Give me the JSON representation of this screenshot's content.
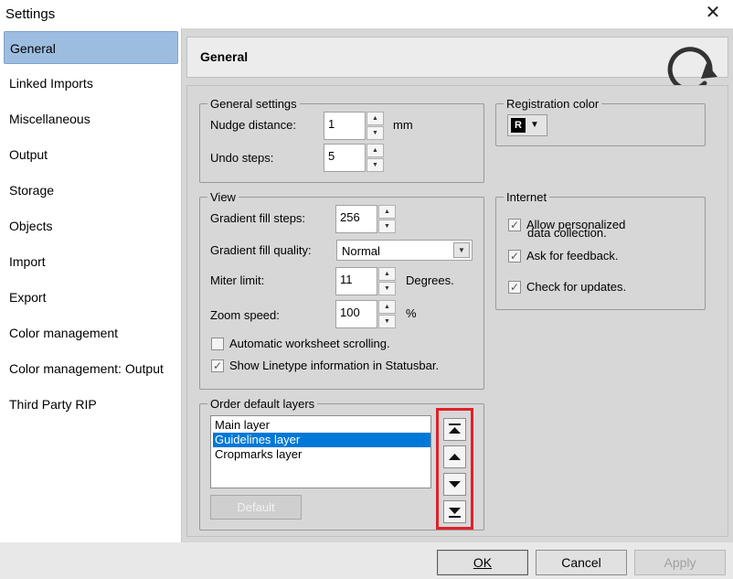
{
  "window": {
    "title": "Settings",
    "close_glyph": "✕"
  },
  "sidebar": {
    "items": [
      {
        "label": "General"
      },
      {
        "label": "Linked Imports"
      },
      {
        "label": "Miscellaneous"
      },
      {
        "label": "Output"
      },
      {
        "label": "Storage"
      },
      {
        "label": "Objects"
      },
      {
        "label": "Import"
      },
      {
        "label": "Export"
      },
      {
        "label": "Color management"
      },
      {
        "label": "Color management: Output"
      },
      {
        "label": "Third Party RIP"
      }
    ],
    "selected": "General"
  },
  "header": {
    "title": "General",
    "icon": "refresh-icon"
  },
  "general_settings": {
    "legend": "General settings",
    "nudge_label": "Nudge distance:",
    "nudge_value": "1",
    "nudge_unit": "mm",
    "undo_label": "Undo steps:",
    "undo_value": "5"
  },
  "registration": {
    "legend": "Registration color",
    "badge": "R"
  },
  "view": {
    "legend": "View",
    "gradient_steps_label": "Gradient fill steps:",
    "gradient_steps_value": "256",
    "gradient_quality_label": "Gradient fill quality:",
    "gradient_quality_value": "Normal",
    "miter_label": "Miter limit:",
    "miter_value": "11",
    "miter_unit": "Degrees.",
    "zoom_label": "Zoom speed:",
    "zoom_value": "100",
    "zoom_unit": "%",
    "auto_scroll_label": "Automatic worksheet scrolling.",
    "auto_scroll_checked": false,
    "linetype_label": "Show Linetype information in Statusbar.",
    "linetype_checked": true
  },
  "internet": {
    "legend": "Internet",
    "personalized_label_1": "Allow personalized",
    "personalized_label_2": "data collection.",
    "personalized_checked": true,
    "feedback_label": "Ask for feedback.",
    "feedback_checked": true,
    "updates_label": "Check for updates.",
    "updates_checked": true
  },
  "layers": {
    "legend": "Order default layers",
    "items": [
      "Main layer",
      "Guidelines layer",
      "Cropmarks layer"
    ],
    "selected": "Guidelines layer",
    "default_button": "Default"
  },
  "buttons": {
    "ok": "OK",
    "cancel": "Cancel",
    "apply": "Apply"
  },
  "colors": {
    "highlight_frame": "#e0202a",
    "selection": "#0078d7",
    "sidebar_selected": "#9dbde0"
  }
}
